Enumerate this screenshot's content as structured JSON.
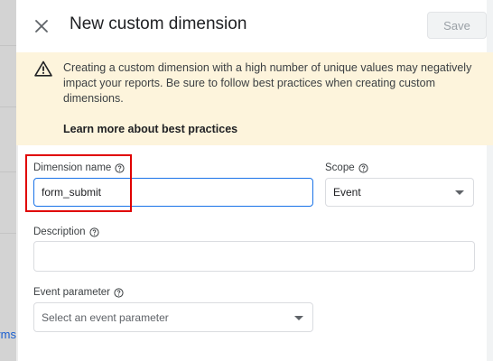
{
  "backdrop": {
    "partial_text": "orms"
  },
  "header": {
    "title": "New custom dimension",
    "save_label": "Save"
  },
  "banner": {
    "message": "Creating a custom dimension with a high number of unique values may negatively impact your reports. Be sure to follow best practices when creating custom dimensions.",
    "link": "Learn more about best practices"
  },
  "form": {
    "dimension_name": {
      "label": "Dimension name",
      "value": "form_submit"
    },
    "scope": {
      "label": "Scope",
      "value": "Event"
    },
    "description": {
      "label": "Description",
      "value": ""
    },
    "event_parameter": {
      "label": "Event parameter",
      "placeholder": "Select an event parameter"
    }
  },
  "colors": {
    "accent": "#1a73e8",
    "banner_bg": "#fdf4dc",
    "highlight": "#e00000"
  }
}
